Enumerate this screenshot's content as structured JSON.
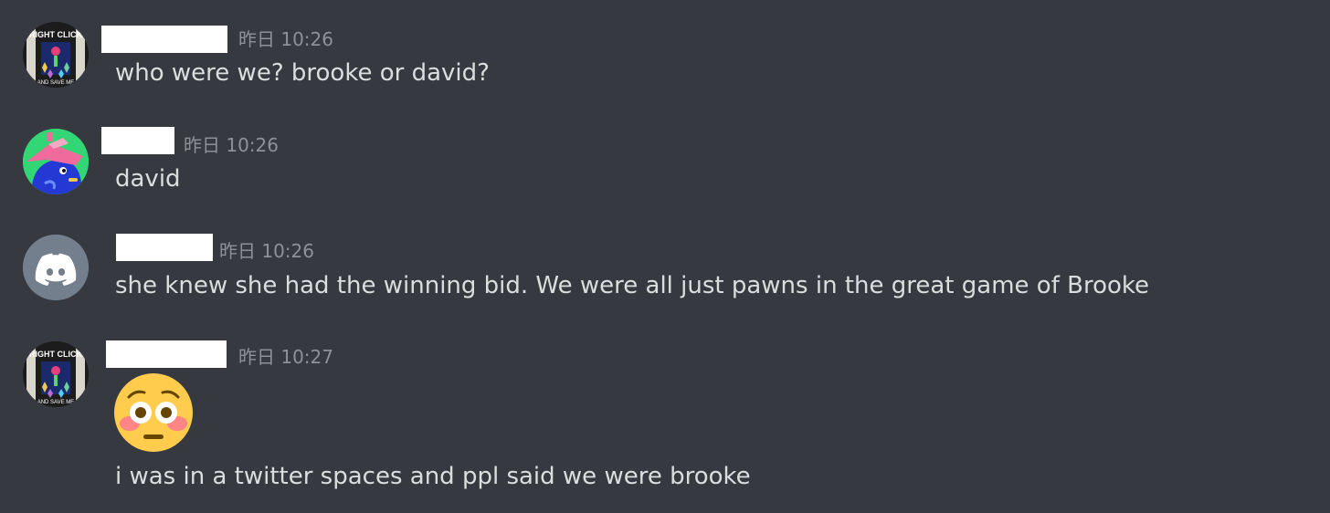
{
  "messages": [
    {
      "avatar": "rightclick-art-avatar",
      "avatar_text_top": "RIGHT CLICK",
      "avatar_text_bottom": "AND SAVE ME",
      "timestamp": "昨日 10:26",
      "text": "who were we? brooke or david?"
    },
    {
      "avatar": "pink-hat-bird-avatar",
      "timestamp": "昨日 10:26",
      "text": "david"
    },
    {
      "avatar": "discord-logo-avatar",
      "timestamp": "昨日 10:26",
      "text": "she knew she had the winning bid. We were all just pawns in the great game of Brooke"
    },
    {
      "avatar": "rightclick-art-avatar",
      "avatar_text_top": "RIGHT CLICK",
      "avatar_text_bottom": "AND SAVE ME",
      "timestamp": "昨日 10:27",
      "emoji": "flushed-face-emoji",
      "text": "i was in a twitter spaces and ppl said we were brooke"
    }
  ],
  "colors": {
    "background": "#36393f",
    "text": "#dcddde",
    "timestamp": "#8e9297",
    "discord_avatar_bg": "#747f8d"
  }
}
